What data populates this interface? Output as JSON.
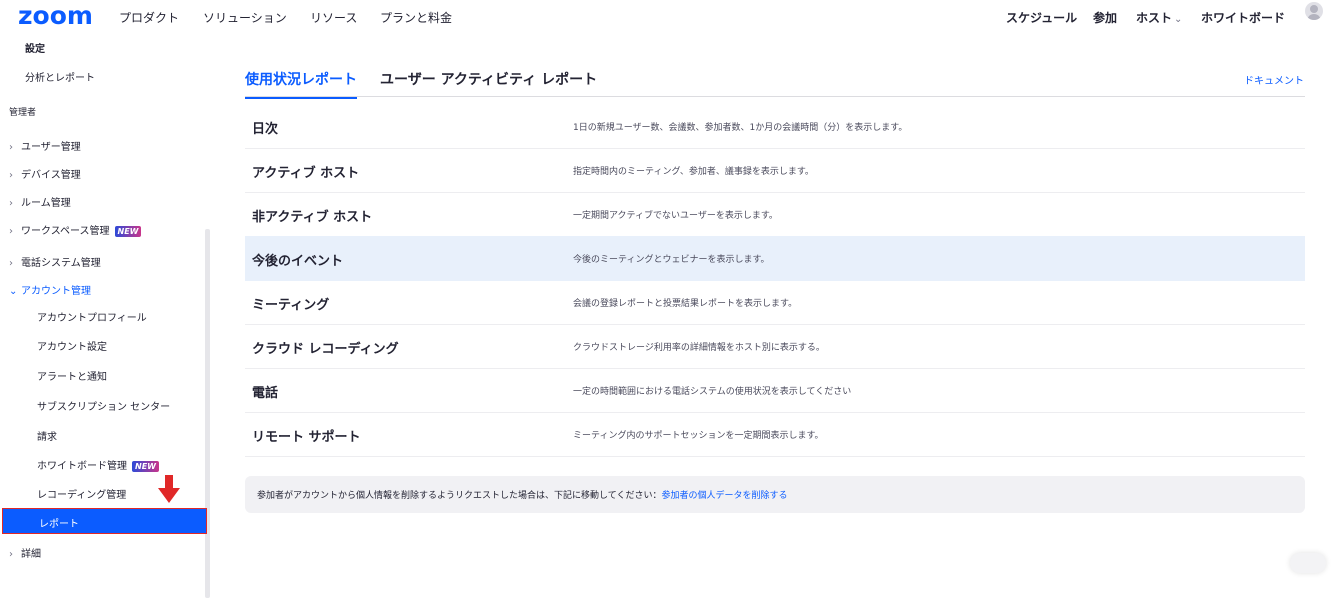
{
  "header": {
    "logo": "zoom",
    "nav_left": [
      "プロダクト",
      "ソリューション",
      "リソース",
      "プランと料金"
    ],
    "nav_right": {
      "schedule": "スケジュール",
      "join": "参加",
      "host": "ホスト",
      "whiteboard": "ホワイトボード"
    }
  },
  "sidebar": {
    "settings": "設定",
    "analytics": "分析とレポート",
    "admin_section": "管理者",
    "user_mgmt": "ユーザー管理",
    "device_mgmt": "デバイス管理",
    "room_mgmt": "ルーム管理",
    "workspace_mgmt": "ワークスペース管理",
    "phone_mgmt": "電話システム管理",
    "account_mgmt": "アカウント管理",
    "account_profile": "アカウントプロフィール",
    "account_settings": "アカウント設定",
    "alerts": "アラートと通知",
    "subscription": "サブスクリプション センター",
    "billing": "請求",
    "whiteboard_mgmt": "ホワイトボード管理",
    "recording_mgmt": "レコーディング管理",
    "reports": "レポート",
    "advanced": "詳細",
    "new_badge": "NEW"
  },
  "main": {
    "tab_usage": "使用状況レポート",
    "tab_activity": "ユーザー アクティビティ レポート",
    "doc_link": "ドキュメント",
    "reports": [
      {
        "title": "日次",
        "desc": "1日の新規ユーザー数、会議数、参加者数、1か月の会議時間（分）を表示します。"
      },
      {
        "title": "アクティブ ホスト",
        "desc": "指定時間内のミーティング、参加者、議事録を表示します。"
      },
      {
        "title": "非アクティブ ホスト",
        "desc": "一定期間アクティブでないユーザーを表示します。"
      },
      {
        "title": "今後のイベント",
        "desc": "今後のミーティングとウェビナーを表示します。"
      },
      {
        "title": "ミーティング",
        "desc": "会議の登録レポートと投票結果レポートを表示します。"
      },
      {
        "title": "クラウド レコーディング",
        "desc": "クラウドストレージ利用率の詳細情報をホスト別に表示する。"
      },
      {
        "title": "電話",
        "desc": "一定の時間範囲における電話システムの使用状況を表示してください"
      },
      {
        "title": "リモート サポート",
        "desc": "ミーティング内のサポートセッションを一定期間表示します。"
      }
    ],
    "notice_text": "参加者がアカウントから個人情報を削除するようリクエストした場合は、下記に移動してください：",
    "notice_link": "参加者の個人データを削除する"
  },
  "colors": {
    "accent": "#0b5cff",
    "highlight_row": "#e8f0fb",
    "annotation": "#e02828"
  }
}
